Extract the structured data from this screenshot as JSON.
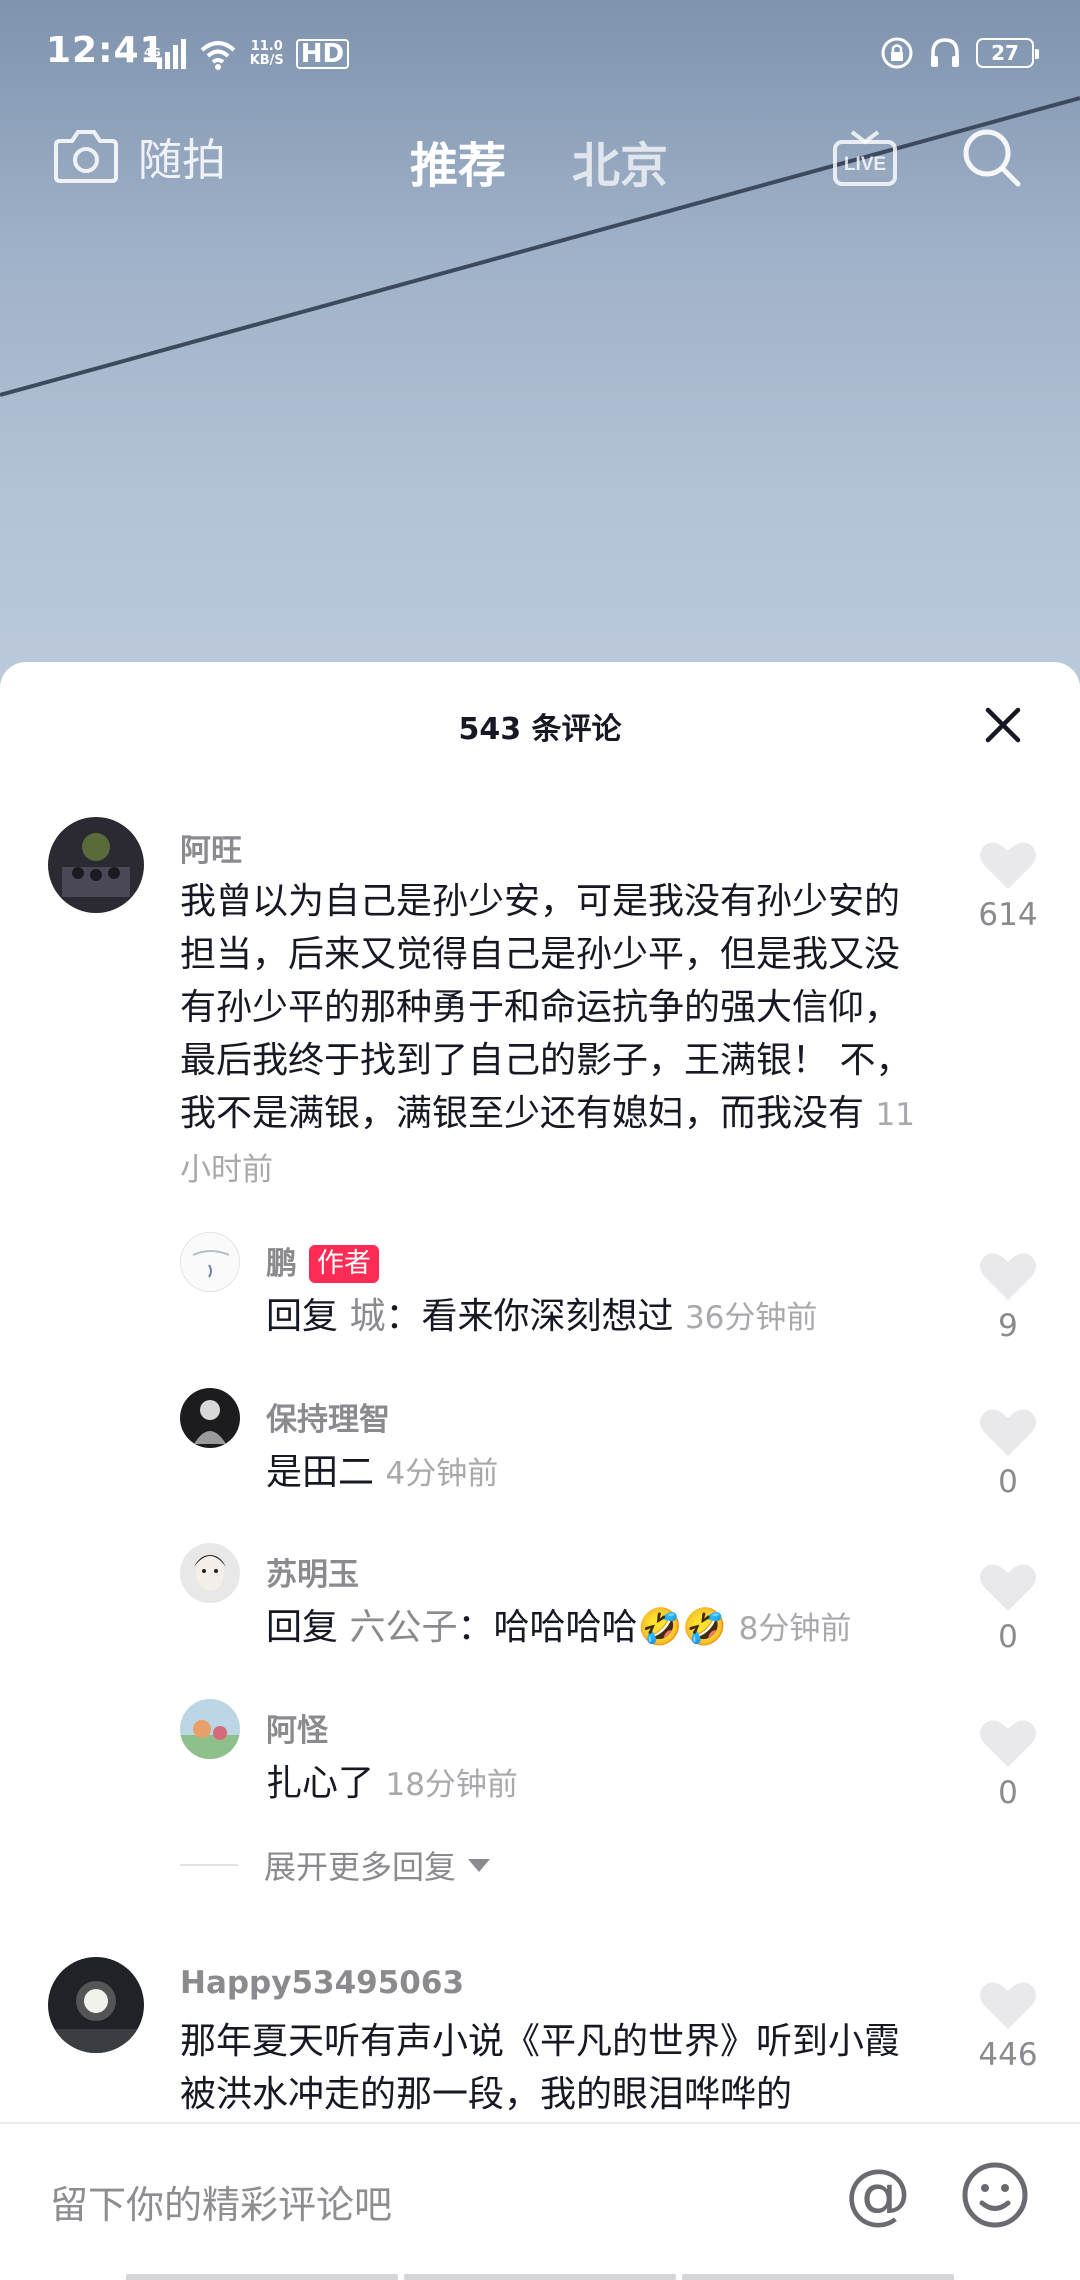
{
  "status_bar": {
    "time": "12:41",
    "network": "4G",
    "speed_value": "11.0",
    "speed_unit": "KB/S",
    "hd": "HD",
    "battery": "27"
  },
  "top_nav": {
    "camera_label": "随拍",
    "tab_active": "推荐",
    "tab_city": "北京",
    "live_label": "LIVE"
  },
  "comments_sheet": {
    "title": "543 条评论",
    "comments": [
      {
        "user": "阿旺",
        "text": "我曾以为自己是孙少安，可是我没有孙少安的担当，后来又觉得自己是孙少平，但是我又没有孙少平的那种勇于和命运抗争的强大信仰，最后我终于找到了自己的影子，王满银！ 不，我不是满银，满银至少还有媳妇，而我没有",
        "time": "11小时前",
        "likes": "614"
      }
    ],
    "replies": [
      {
        "user": "鹏",
        "badge": "作者",
        "reply_prefix": "回复",
        "reply_to": "城",
        "text": "：看来你深刻想过",
        "time": "36分钟前",
        "likes": "9"
      },
      {
        "user": "保持理智",
        "text": "是田二",
        "time": "4分钟前",
        "likes": "0"
      },
      {
        "user": "苏明玉",
        "reply_prefix": "回复",
        "reply_to": "六公子",
        "text": "：哈哈哈哈🤣🤣",
        "time": "8分钟前",
        "likes": "0"
      },
      {
        "user": "阿怪",
        "text": "扎心了",
        "time": "18分钟前",
        "likes": "0"
      }
    ],
    "expand_label": "展开更多回复",
    "comment2": {
      "user": "Happy53495063",
      "text": "那年夏天听有声小说《平凡的世界》听到小霞被洪水冲走的那一段，我的眼泪哗哗的",
      "likes": "446"
    }
  },
  "input_bar": {
    "placeholder": "留下你的精彩评论吧",
    "at_symbol": "@"
  }
}
